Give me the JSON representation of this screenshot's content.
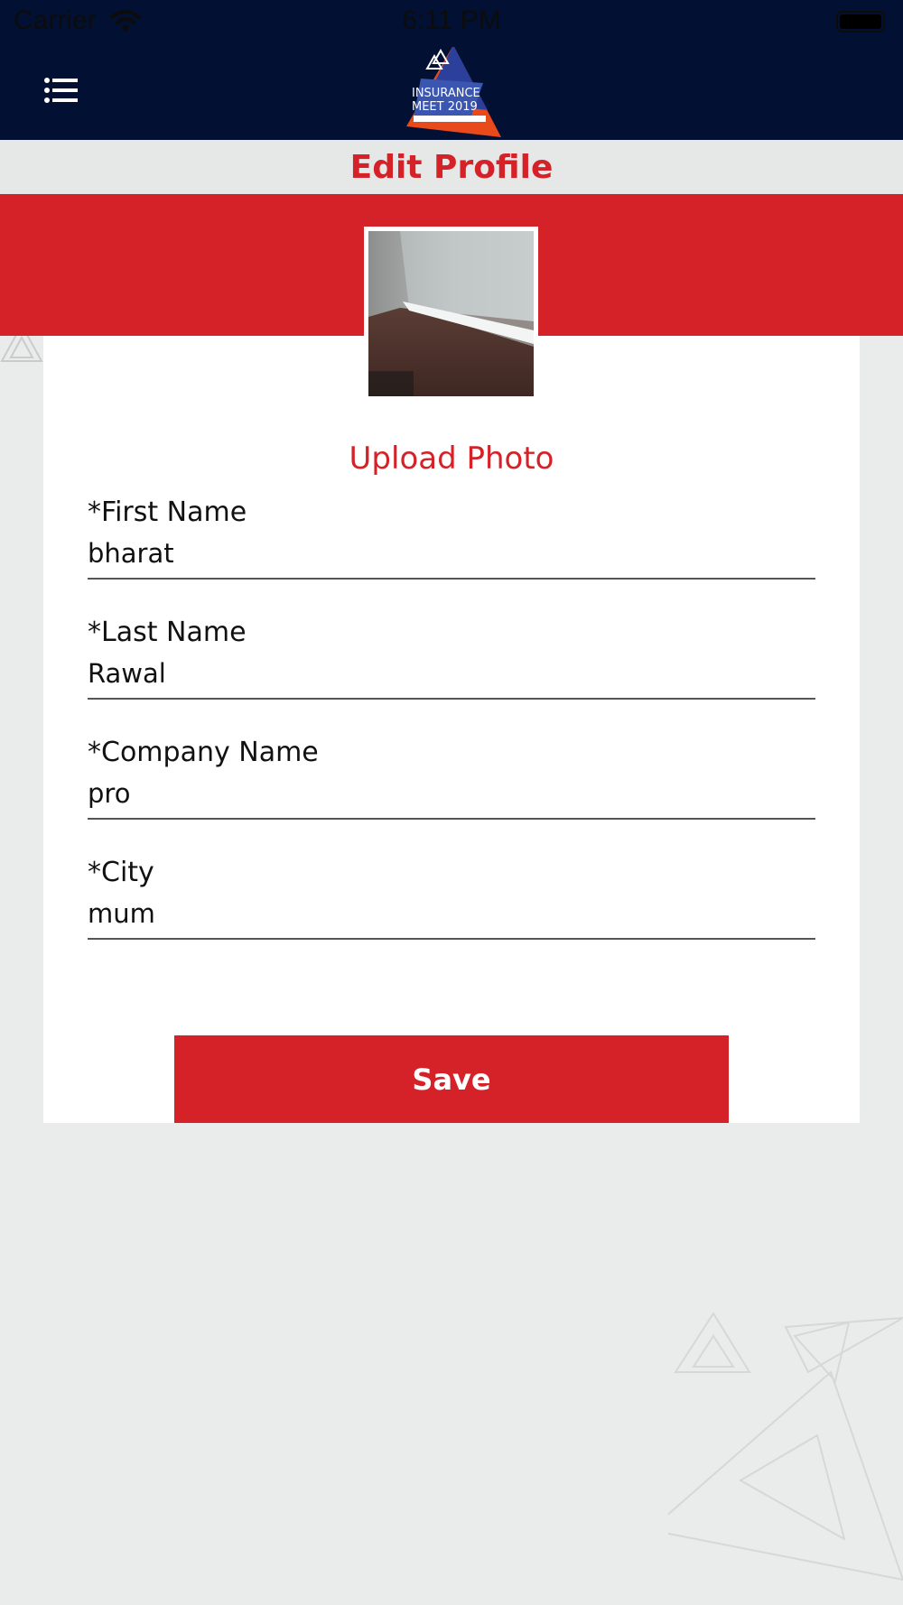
{
  "status_bar": {
    "carrier": "Carrier",
    "time": "6:11 PM"
  },
  "header": {
    "logo_icon": "insurance-meet-logo",
    "menu_icon": "list-menu-icon"
  },
  "page": {
    "title": "Edit Profile"
  },
  "profile": {
    "upload_label": "Upload Photo"
  },
  "form": {
    "fields": [
      {
        "label": "*First Name",
        "value": "bharat"
      },
      {
        "label": "*Last Name",
        "value": "Rawal"
      },
      {
        "label": "*Company Name",
        "value": "pro"
      },
      {
        "label": "*City",
        "value": "mum"
      }
    ],
    "save_label": "Save"
  },
  "colors": {
    "navy": "#021033",
    "accent_red": "#d52229",
    "background": "#eaeceb"
  }
}
